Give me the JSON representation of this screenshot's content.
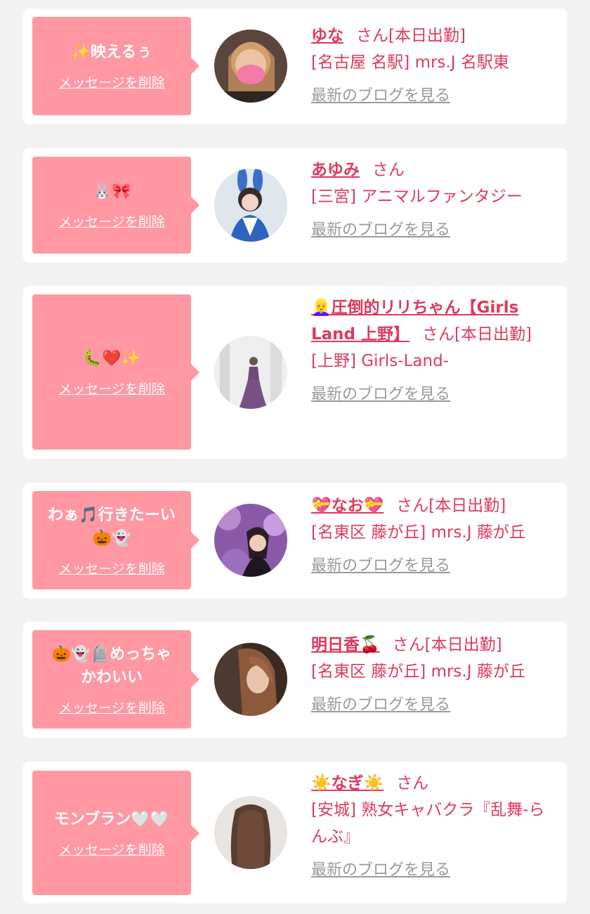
{
  "delete_label": "メッセージを削除",
  "san_label": "さん",
  "blog_label": "最新のブログを見る",
  "colors": {
    "page_background": "#f2f2f2",
    "card_background": "#ffffff",
    "bubble": "#ff98a3",
    "accent_text": "#dd3a5e",
    "muted_link": "#9a9a9a"
  },
  "cards": [
    {
      "message": "✨映えるぅ",
      "name": "ゆな",
      "status": "[本日出勤]",
      "shop": "[名古屋 名駅] mrs.J 名駅東"
    },
    {
      "message": "🐰🎀",
      "name": "あゆみ",
      "status": "",
      "shop": "[三宮] アニマルファンタジー"
    },
    {
      "message": "🐛❤️✨",
      "name": "👱‍♀️圧倒的リリちゃん【Girls Land 上野】",
      "status": "[本日出勤]",
      "shop": "[上野] Girls-Land-"
    },
    {
      "message": "わぁ🎵行きたーい\n🎃👻",
      "name": "💝なお💝",
      "status": "[本日出勤]",
      "shop": "[名東区 藤が丘] mrs.J 藤が丘"
    },
    {
      "message": "🎃👻🪦めっちゃ\nかわいい",
      "name": "明日香🍒",
      "status": "[本日出勤]",
      "shop": "[名東区 藤が丘] mrs.J 藤が丘"
    },
    {
      "message": "モンブラン🤍🤍",
      "name": "☀️なぎ☀️",
      "status": "",
      "shop": "[安城] 熟女キャバクラ『乱舞-らんぶ』"
    }
  ]
}
